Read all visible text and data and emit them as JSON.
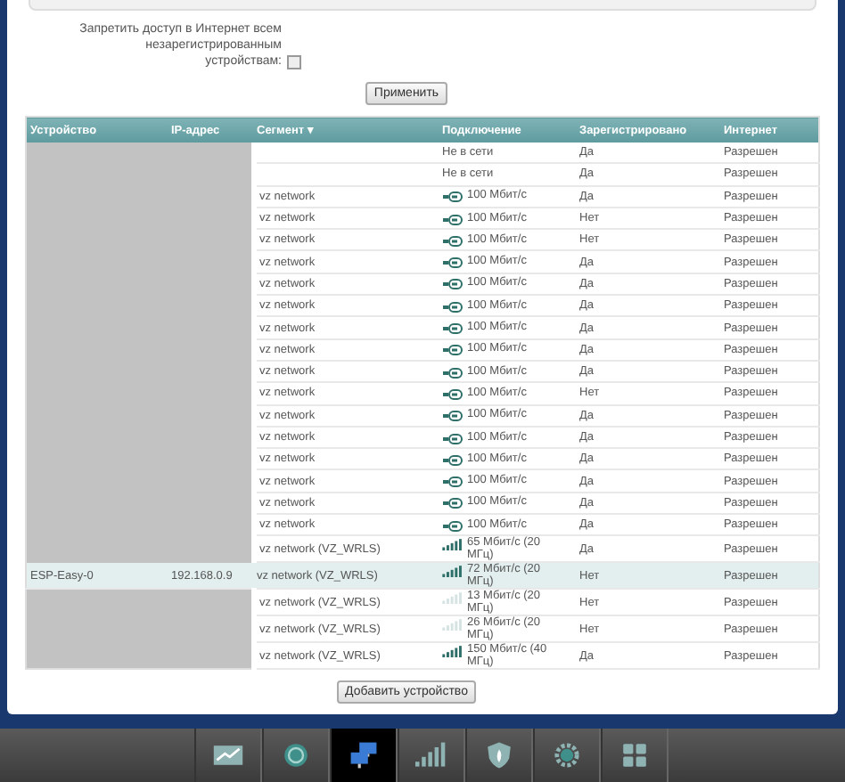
{
  "settings": {
    "block_label": "Запретить доступ в Интернет всем незарегистрированным устройствам:",
    "block_checked": false,
    "apply_button": "Применить"
  },
  "table": {
    "columns": [
      "Устройство",
      "IP-адрес",
      "Сегмент ▾",
      "Подключение",
      "Зарегистрировано",
      "Интернет"
    ],
    "rows": [
      {
        "redacted": true,
        "segment": "",
        "kind": "offline",
        "connection": "Не в сети",
        "registered": "Да",
        "internet": "Разрешен",
        "selected": false
      },
      {
        "redacted": true,
        "segment": "",
        "kind": "offline",
        "connection": "Не в сети",
        "registered": "Да",
        "internet": "Разрешен",
        "selected": false
      },
      {
        "redacted": true,
        "segment": "vz network",
        "kind": "wired",
        "connection": "100 Мбит/с",
        "registered": "Да",
        "internet": "Разрешен",
        "selected": false
      },
      {
        "redacted": true,
        "segment": "vz network",
        "kind": "wired",
        "connection": "100 Мбит/с",
        "registered": "Нет",
        "internet": "Разрешен",
        "selected": false
      },
      {
        "redacted": true,
        "segment": "vz network",
        "kind": "wired",
        "connection": "100 Мбит/с",
        "registered": "Нет",
        "internet": "Разрешен",
        "selected": false
      },
      {
        "redacted": true,
        "segment": "vz network",
        "kind": "wired",
        "connection": "100 Мбит/с",
        "registered": "Да",
        "internet": "Разрешен",
        "selected": false
      },
      {
        "redacted": true,
        "segment": "vz network",
        "kind": "wired",
        "connection": "100 Мбит/с",
        "registered": "Да",
        "internet": "Разрешен",
        "selected": false
      },
      {
        "redacted": true,
        "segment": "vz network",
        "kind": "wired",
        "connection": "100 Мбит/с",
        "registered": "Да",
        "internet": "Разрешен",
        "selected": false
      },
      {
        "redacted": true,
        "segment": "vz network",
        "kind": "wired",
        "connection": "100 Мбит/с",
        "registered": "Да",
        "internet": "Разрешен",
        "selected": false
      },
      {
        "redacted": true,
        "segment": "vz network",
        "kind": "wired",
        "connection": "100 Мбит/с",
        "registered": "Да",
        "internet": "Разрешен",
        "selected": false
      },
      {
        "redacted": true,
        "segment": "vz network",
        "kind": "wired",
        "connection": "100 Мбит/с",
        "registered": "Да",
        "internet": "Разрешен",
        "selected": false
      },
      {
        "redacted": true,
        "segment": "vz network",
        "kind": "wired",
        "connection": "100 Мбит/с",
        "registered": "Нет",
        "internet": "Разрешен",
        "selected": false
      },
      {
        "redacted": true,
        "segment": "vz network",
        "kind": "wired",
        "connection": "100 Мбит/с",
        "registered": "Да",
        "internet": "Разрешен",
        "selected": false
      },
      {
        "redacted": true,
        "segment": "vz network",
        "kind": "wired",
        "connection": "100 Мбит/с",
        "registered": "Да",
        "internet": "Разрешен",
        "selected": false
      },
      {
        "redacted": true,
        "segment": "vz network",
        "kind": "wired",
        "connection": "100 Мбит/с",
        "registered": "Да",
        "internet": "Разрешен",
        "selected": false
      },
      {
        "redacted": true,
        "segment": "vz network",
        "kind": "wired",
        "connection": "100 Мбит/с",
        "registered": "Да",
        "internet": "Разрешен",
        "selected": false
      },
      {
        "redacted": true,
        "segment": "vz network",
        "kind": "wired",
        "connection": "100 Мбит/с",
        "registered": "Да",
        "internet": "Разрешен",
        "selected": false
      },
      {
        "redacted": true,
        "segment": "vz network",
        "kind": "wired",
        "connection": "100 Мбит/с",
        "registered": "Да",
        "internet": "Разрешен",
        "selected": false
      },
      {
        "redacted": true,
        "segment": "vz network (VZ_WRLS)",
        "kind": "wireless",
        "weak": false,
        "connection": "65 Мбит/с (20 МГц)",
        "registered": "Да",
        "internet": "Разрешен",
        "selected": false
      },
      {
        "redacted": false,
        "device": "ESP-Easy-0",
        "ip": "192.168.0.9",
        "segment": "vz network (VZ_WRLS)",
        "kind": "wireless",
        "weak": false,
        "connection": "72 Мбит/с (20 МГц)",
        "registered": "Нет",
        "internet": "Разрешен",
        "selected": true
      },
      {
        "redacted": true,
        "segment": "vz network (VZ_WRLS)",
        "kind": "wireless",
        "weak": true,
        "connection": "13 Мбит/с (20 МГц)",
        "registered": "Нет",
        "internet": "Разрешен",
        "selected": false
      },
      {
        "redacted": true,
        "segment": "vz network (VZ_WRLS)",
        "kind": "wireless",
        "weak": true,
        "connection": "26 Мбит/с (20 МГц)",
        "registered": "Нет",
        "internet": "Разрешен",
        "selected": false
      },
      {
        "redacted": true,
        "segment": "vz network (VZ_WRLS)",
        "kind": "wireless",
        "weak": false,
        "connection": "150 Мбит/с (40 МГц)",
        "registered": "Да",
        "internet": "Разрешен",
        "selected": false
      }
    ]
  },
  "add_button": "Добавить устройство",
  "nav": [
    {
      "kind": "chart",
      "selected": false
    },
    {
      "kind": "globe",
      "selected": false
    },
    {
      "kind": "network",
      "selected": true
    },
    {
      "kind": "signal",
      "selected": false
    },
    {
      "kind": "shield",
      "selected": false
    },
    {
      "kind": "gear",
      "selected": false
    },
    {
      "kind": "apps",
      "selected": false
    }
  ]
}
